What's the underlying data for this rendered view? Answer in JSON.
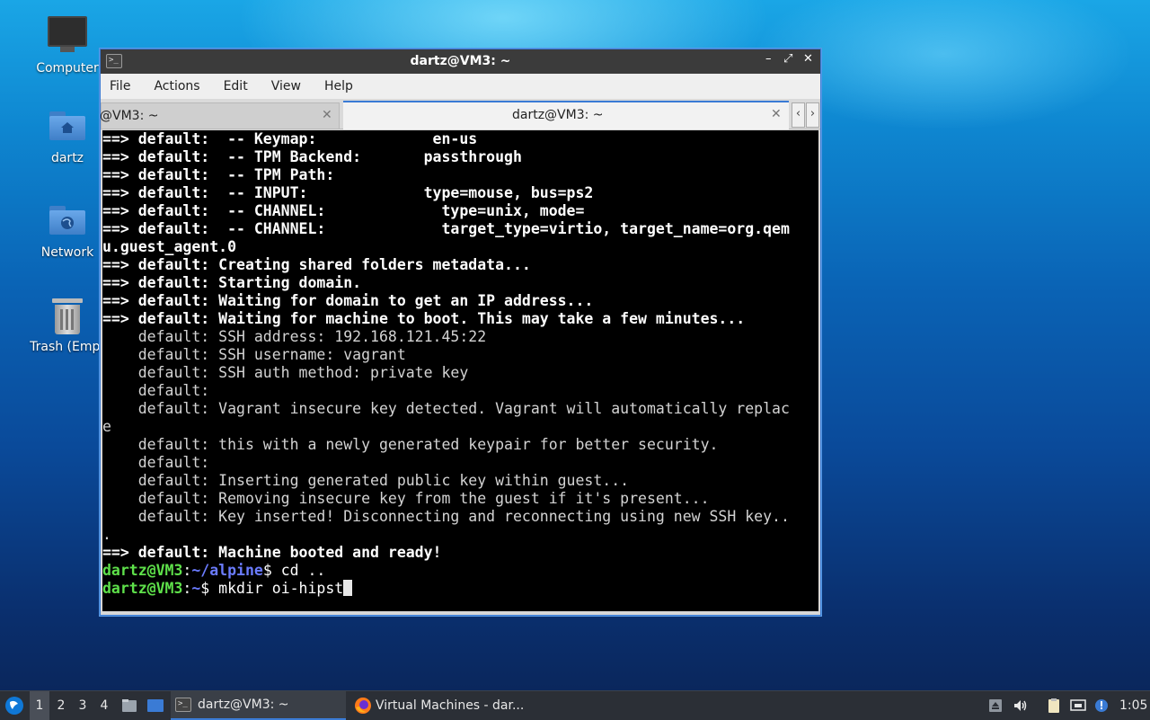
{
  "desktop": {
    "icons": [
      {
        "label": "Computer"
      },
      {
        "label": "dartz"
      },
      {
        "label": "Network"
      },
      {
        "label": "Trash (Empt"
      }
    ]
  },
  "window": {
    "title": "dartz@VM3: ~",
    "controls": {
      "minimize": "–",
      "maximize": "⤢",
      "close": "✕"
    },
    "menu": [
      "File",
      "Actions",
      "Edit",
      "View",
      "Help"
    ],
    "tabs": [
      {
        "label": "@VM3: ~",
        "active": false
      },
      {
        "label": "dartz@VM3: ~",
        "active": true
      }
    ],
    "scroll_left": "‹",
    "scroll_right": "›"
  },
  "terminal": {
    "lines": [
      {
        "type": "bold",
        "text": "==> default:  -- Keymap:             en-us"
      },
      {
        "type": "bold",
        "text": "==> default:  -- TPM Backend:       passthrough"
      },
      {
        "type": "bold",
        "text": "==> default:  -- TPM Path:"
      },
      {
        "type": "bold",
        "text": "==> default:  -- INPUT:             type=mouse, bus=ps2"
      },
      {
        "type": "bold",
        "text": "==> default:  -- CHANNEL:             type=unix, mode="
      },
      {
        "type": "bold",
        "text": "==> default:  -- CHANNEL:             target_type=virtio, target_name=org.qem"
      },
      {
        "type": "bold",
        "text": "u.guest_agent.0"
      },
      {
        "type": "bold",
        "text": "==> default: Creating shared folders metadata..."
      },
      {
        "type": "bold",
        "text": "==> default: Starting domain."
      },
      {
        "type": "bold",
        "text": "==> default: Waiting for domain to get an IP address..."
      },
      {
        "type": "bold",
        "text": "==> default: Waiting for machine to boot. This may take a few minutes..."
      },
      {
        "type": "normal",
        "text": "    default: SSH address: 192.168.121.45:22"
      },
      {
        "type": "normal",
        "text": "    default: SSH username: vagrant"
      },
      {
        "type": "normal",
        "text": "    default: SSH auth method: private key"
      },
      {
        "type": "normal",
        "text": "    default:"
      },
      {
        "type": "normal",
        "text": "    default: Vagrant insecure key detected. Vagrant will automatically replac"
      },
      {
        "type": "normal",
        "text": "e"
      },
      {
        "type": "normal",
        "text": "    default: this with a newly generated keypair for better security."
      },
      {
        "type": "normal",
        "text": "    default:"
      },
      {
        "type": "normal",
        "text": "    default: Inserting generated public key within guest..."
      },
      {
        "type": "normal",
        "text": "    default: Removing insecure key from the guest if it's present..."
      },
      {
        "type": "normal",
        "text": "    default: Key inserted! Disconnecting and reconnecting using new SSH key.."
      },
      {
        "type": "normal",
        "text": "."
      },
      {
        "type": "bold",
        "text": "==> default: Machine booted and ready!"
      }
    ],
    "prompts": [
      {
        "user": "dartz@VM3",
        "path": "~/alpine",
        "cmd": " cd .."
      },
      {
        "user": "dartz@VM3",
        "path": "~",
        "cmd": " mkdir oi-hipst"
      }
    ]
  },
  "taskbar": {
    "workspaces": [
      "1",
      "2",
      "3",
      "4"
    ],
    "tasks": [
      {
        "label": "dartz@VM3: ~",
        "icon": "terminal-icon",
        "active": true
      },
      {
        "label": "Virtual Machines - dar...",
        "icon": "firefox-icon",
        "active": false
      }
    ],
    "clock": "1:05"
  }
}
